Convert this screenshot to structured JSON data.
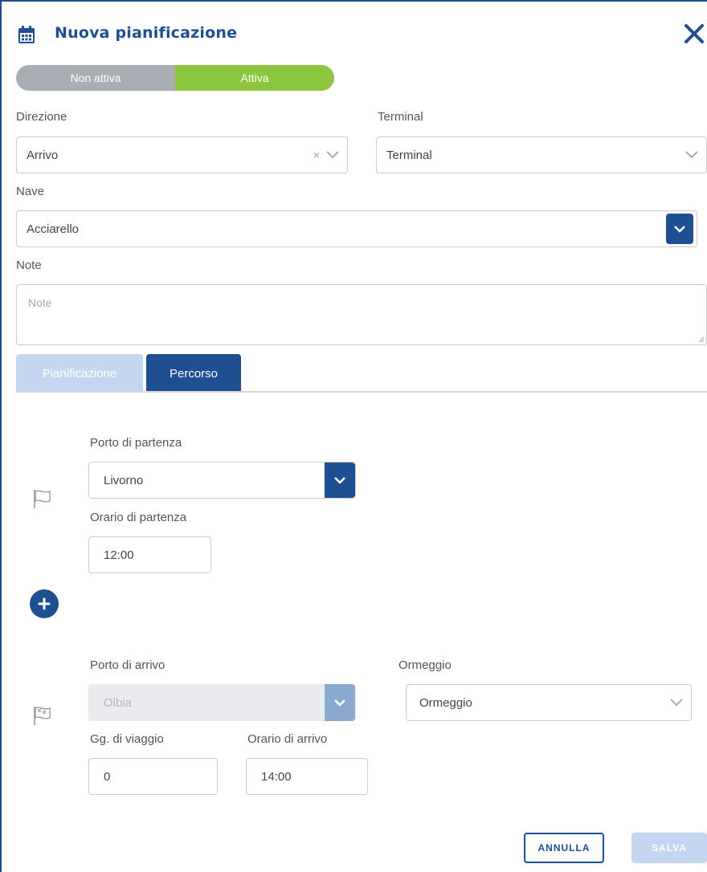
{
  "header": {
    "title": "Nuova pianificazione",
    "calendar_icon": "calendar-icon",
    "close_icon": "close-icon"
  },
  "status_toggle": {
    "off_label": "Non attiva",
    "on_label": "Attiva",
    "selected": "Attiva",
    "off_color": "#a9aeb5",
    "on_color": "#8cc63e"
  },
  "form": {
    "direzione": {
      "label": "Direzione",
      "value": "Arrivo",
      "clear_icon": "×"
    },
    "terminal": {
      "label": "Terminal",
      "value": "Terminal"
    },
    "nave": {
      "label": "Nave",
      "value": "Acciarello"
    },
    "note": {
      "label": "Note",
      "placeholder": "Note"
    }
  },
  "tabs": [
    {
      "label": "Pianificazione",
      "active": false
    },
    {
      "label": "Percorso",
      "active": true
    }
  ],
  "percorso": {
    "partenza": {
      "porto_label": "Porto di partenza",
      "porto_value": "Livorno",
      "orario_label": "Orario di partenza",
      "orario_value": "12:00",
      "flag_icon": "flag-outline-icon"
    },
    "add_icon": "plus-circle-icon",
    "arrivo": {
      "porto_label": "Porto di arrivo",
      "porto_value": "Olbia",
      "ormeggio_label": "Ormeggio",
      "ormeggio_value": "Ormeggio",
      "giorni_label": "Gg. di viaggio",
      "giorni_value": "0",
      "orario_label": "Orario di arrivo",
      "orario_value": "14:00",
      "flag_icon": "checkered-flag-icon"
    }
  },
  "footer": {
    "cancel_label": "ANNULLA",
    "save_label": "SALVA"
  },
  "colors": {
    "primary": "#1d4f91",
    "primary_light": "#c3d8f0",
    "active_green": "#8cc63e",
    "inactive_gray": "#a9aeb5"
  }
}
